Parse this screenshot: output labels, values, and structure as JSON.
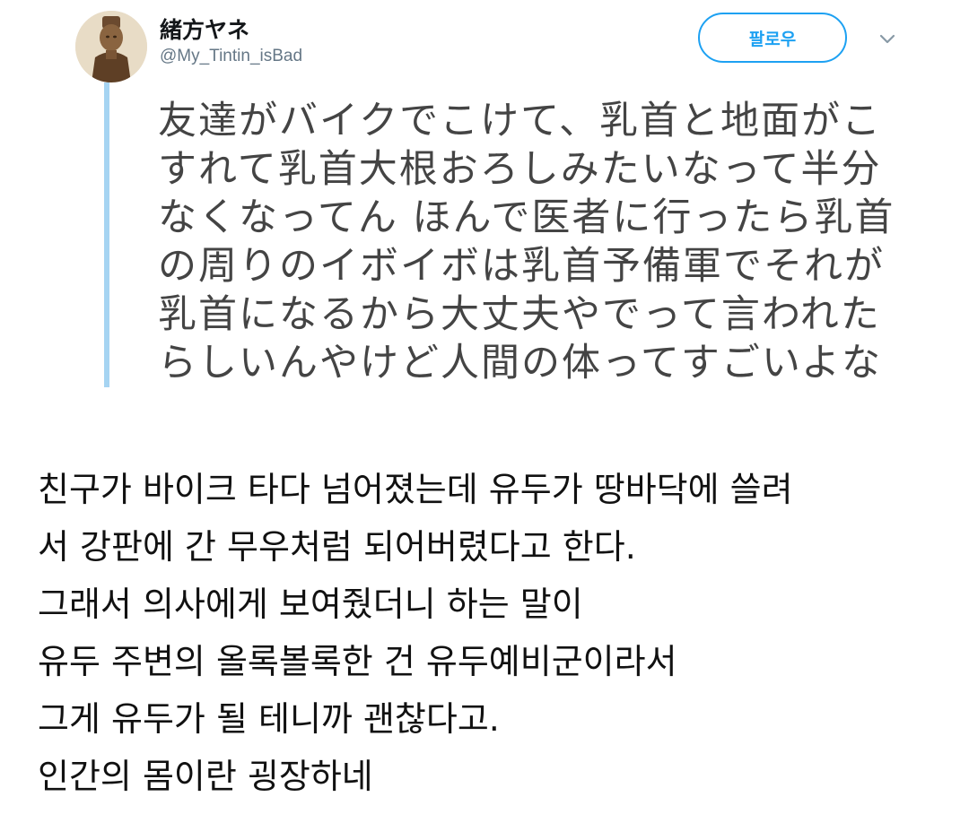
{
  "tweet": {
    "display_name": "緒方ヤネ",
    "handle": "@My_Tintin_isBad",
    "follow_label": "팔로우",
    "caret_icon": "chevron-down-icon",
    "accent_color": "#1da1f2",
    "quote_lines": [
      "友達がバイクでこけて、乳首と地面がこ",
      "すれて乳首大根おろしみたいなって半分",
      "なくなってん ほんで医者に行ったら乳首",
      "の周りのイボイボは乳首予備軍でそれが",
      "乳首になるから大丈夫やでって言われた",
      "らしいんやけど人間の体ってすごいよな"
    ]
  },
  "translation": {
    "lines": [
      "친구가 바이크 타다 넘어졌는데 유두가 땅바닥에 쓸려",
      "서 강판에 간 무우처럼 되어버렸다고 한다.",
      "그래서 의사에게 보여줬더니 하는 말이",
      "유두 주변의 올록볼록한 건 유두예비군이라서",
      "그게 유두가 될 테니까 괜찮다고.",
      "인간의 몸이란 굉장하네"
    ]
  }
}
